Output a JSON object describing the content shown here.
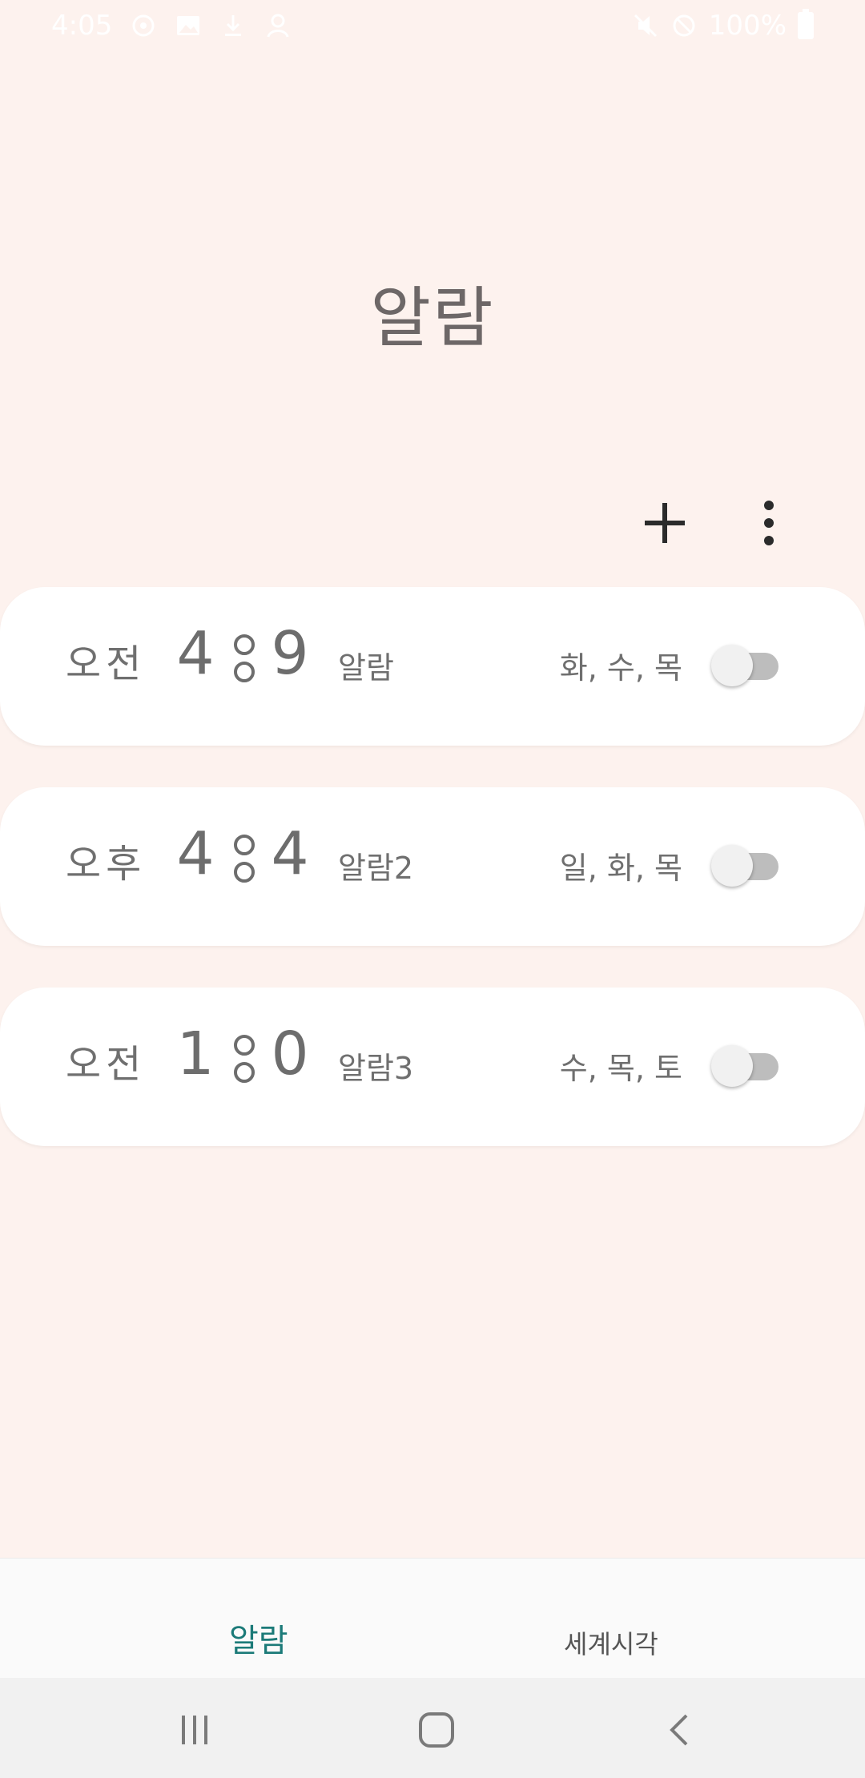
{
  "status_bar": {
    "time": "4:05",
    "battery": "100%",
    "left_icons": [
      "sync-icon",
      "image-icon",
      "download-icon",
      "person-icon"
    ],
    "right_icons": [
      "mute-icon",
      "blocked-icon",
      "battery-icon"
    ]
  },
  "page": {
    "title": "알람"
  },
  "toolbar": {
    "add_icon": "plus-icon",
    "more_icon": "more-vert-icon"
  },
  "alarms": [
    {
      "ampm": "오전",
      "hour": "4",
      "minute": "9",
      "label": "알람",
      "days": "화, 수, 목",
      "enabled": false
    },
    {
      "ampm": "오후",
      "hour": "4",
      "minute": "4",
      "label": "알람2",
      "days": "일, 화, 목",
      "enabled": false
    },
    {
      "ampm": "오전",
      "hour": "1",
      "minute": "0",
      "label": "알람3",
      "days": "수, 목, 토",
      "enabled": false
    }
  ],
  "tabs": [
    {
      "label": "알람",
      "active": true
    },
    {
      "label": "세계시각",
      "active": false
    }
  ],
  "colors": {
    "background": "#FDF2EE",
    "card": "#FFFFFF",
    "text": "#6F6F6F",
    "active_tab": "#1B7A78",
    "toggle_track": "#BDBDBD"
  }
}
